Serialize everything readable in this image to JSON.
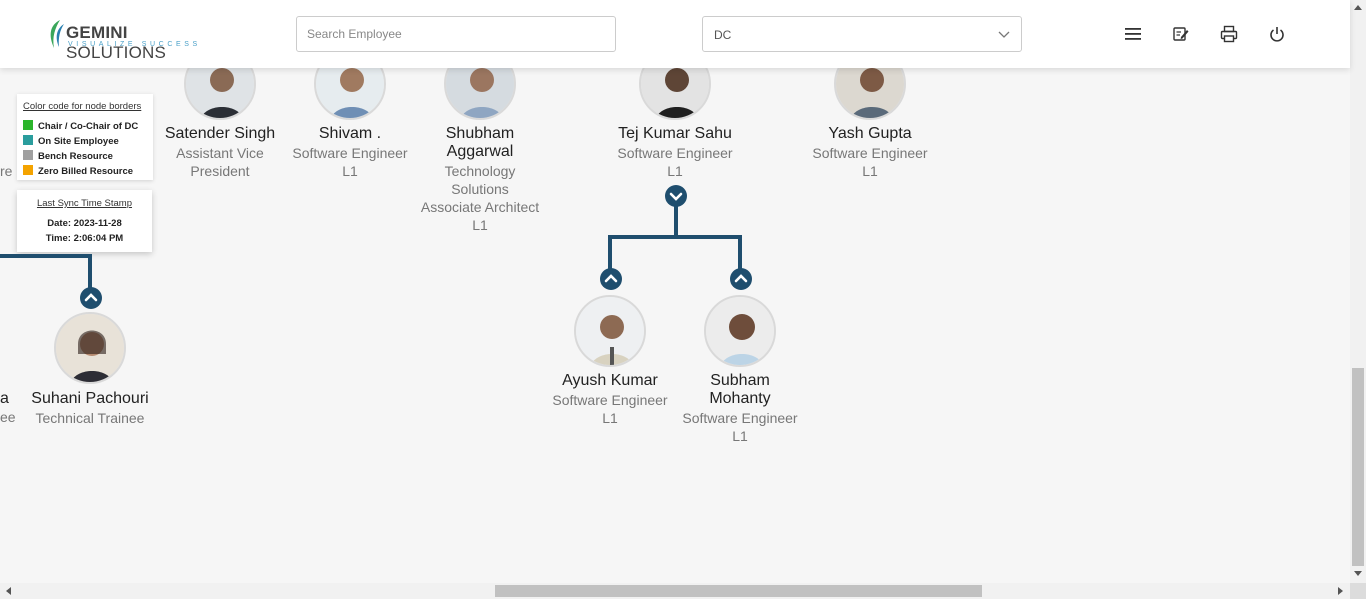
{
  "header": {
    "logo_main": "GEMINI",
    "logo_main2": "SOLUTIONS",
    "logo_tagline": "VISUALIZE SUCCESS",
    "search_placeholder": "Search Employee",
    "department_selected": "DC",
    "icons": [
      "menu-icon",
      "notes-icon",
      "print-icon",
      "power-icon"
    ]
  },
  "legend": {
    "title": "Color code for node borders",
    "items": [
      {
        "label": "Chair / Co-Chair of DC",
        "color": "#2bb52b"
      },
      {
        "label": "On Site Employee",
        "color": "#2a9d9d"
      },
      {
        "label": "Bench Resource",
        "color": "#a0a0a0"
      },
      {
        "label": "Zero Billed Resource",
        "color": "#f4a300"
      }
    ]
  },
  "sync": {
    "title": "Last Sync Time Stamp",
    "date": "Date: 2023-11-28",
    "time": "Time: 2:06:04 PM"
  },
  "partial": {
    "left_top_fragment": "re",
    "left_name_fragment": "a",
    "left_role_fragment": "ee"
  },
  "employees": [
    {
      "name": "Satender Singh",
      "role_line1": "Assistant Vice",
      "role_line2": "President"
    },
    {
      "name": "Shivam .",
      "role_line1": "Software Engineer",
      "role_line2": "L1"
    },
    {
      "name_line1": "Shubham",
      "name_line2": "Aggarwal",
      "role_line1": "Technology",
      "role_line2": "Solutions",
      "role_line3": "Associate Architect",
      "role_line4": "L1"
    },
    {
      "name": "Tej Kumar Sahu",
      "role_line1": "Software Engineer",
      "role_line2": "L1"
    },
    {
      "name": "Yash Gupta",
      "role_line1": "Software Engineer",
      "role_line2": "L1"
    },
    {
      "name": "Suhani Pachouri",
      "role_line1": "Technical Trainee"
    },
    {
      "name": "Ayush Kumar",
      "role_line1": "Software Engineer",
      "role_line2": "L1"
    },
    {
      "name_line1": "Subham",
      "name_line2": "Mohanty",
      "role_line1": "Software Engineer",
      "role_line2": "L1"
    }
  ],
  "colors": {
    "connector": "#1f4e6e",
    "accent": "#4aa0c8"
  }
}
